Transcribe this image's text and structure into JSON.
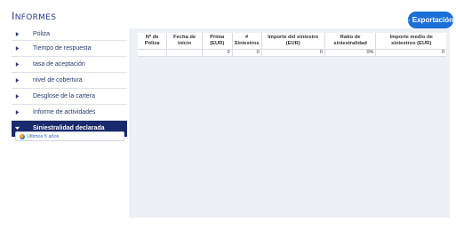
{
  "header": {
    "title_initial": "I",
    "title_rest": "NFORMES",
    "export_label": "Exportación",
    "export_icon": "arrow-right-icon"
  },
  "sidebar": {
    "items": [
      {
        "label": "Póliza",
        "active": false
      },
      {
        "label": "Tiempo de respuesta",
        "active": false
      },
      {
        "label": "tasa de aceptación",
        "active": false
      },
      {
        "label": "nivel de cobertura",
        "active": false
      },
      {
        "label": "Desglose de la cartera",
        "active": false
      },
      {
        "label": "Informe de actividades",
        "active": false
      },
      {
        "label": "Siniestralidad declarada",
        "active": true
      }
    ],
    "period": {
      "label": "Ultimos 5 años",
      "icon": "globe-icon"
    }
  },
  "table": {
    "columns": [
      "Nº de Póliza",
      "Fecha de inicio",
      "Prima (EUR)",
      "# Siniestros",
      "Importe del siniestro (EUR)",
      "Ratio de siniestralidad",
      "Importe medio de siniestros (EUR)"
    ],
    "rows": [
      [
        "",
        "",
        "0",
        "0",
        "0",
        "0%",
        "0"
      ]
    ]
  },
  "colors": {
    "accent": "#1d6fd8",
    "nav_active": "#1a2a6c",
    "panel_bg": "#edf0f5"
  }
}
